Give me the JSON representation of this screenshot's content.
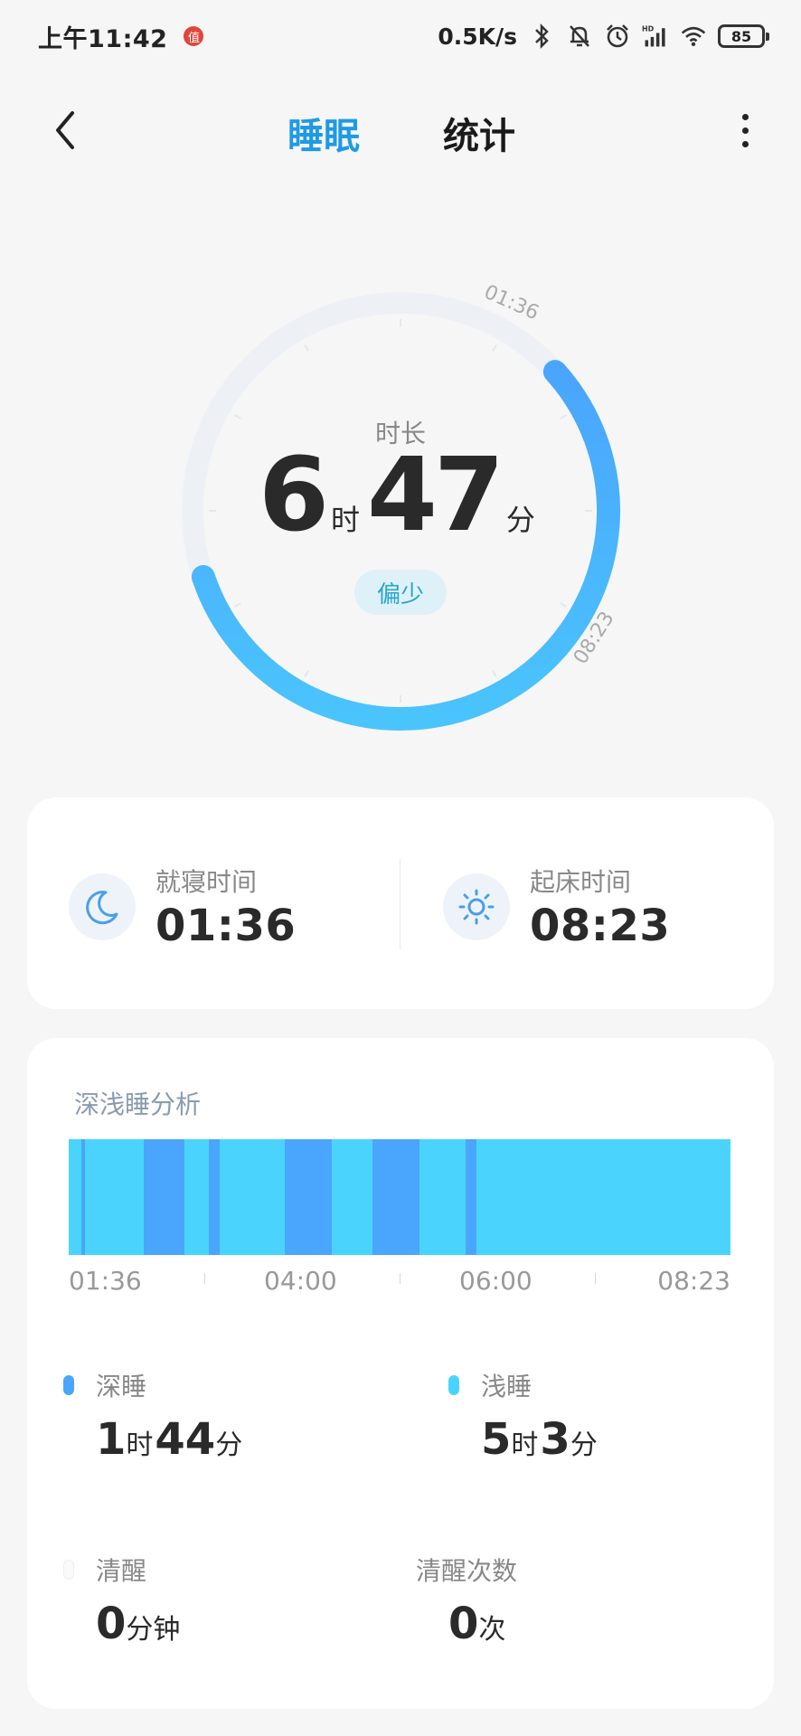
{
  "status_bar": {
    "time": "上午11:42",
    "app_icon_text": "值",
    "net_speed": "0.5K/s",
    "battery": "85",
    "icons": [
      "bluetooth-icon",
      "bell-muted-icon",
      "alarm-icon",
      "hd-signal-icon",
      "wifi-icon",
      "battery-icon"
    ]
  },
  "header": {
    "tabs": [
      {
        "label": "睡眠",
        "active": true
      },
      {
        "label": "统计",
        "active": false
      }
    ]
  },
  "summary": {
    "label": "时长",
    "hours": "6",
    "hours_unit": "时",
    "minutes": "47",
    "minutes_unit": "分",
    "quality": "偏少",
    "arc_start": "01:36",
    "arc_end": "08:23"
  },
  "times": {
    "bedtime": {
      "label": "就寝时间",
      "value": "01:36",
      "icon": "moon-icon"
    },
    "wake": {
      "label": "起床时间",
      "value": "08:23",
      "icon": "sun-icon"
    }
  },
  "analysis": {
    "title": "深浅睡分析",
    "axis": [
      "01:36",
      "04:00",
      "06:00",
      "08:23"
    ],
    "colors": {
      "light": "#4ad4fd",
      "deep": "#4aa5fd"
    },
    "deep_segments": [
      {
        "start": "01:44",
        "end": "01:46"
      },
      {
        "start": "02:22",
        "end": "02:47"
      },
      {
        "start": "03:02",
        "end": "03:09"
      },
      {
        "start": "03:49",
        "end": "04:18"
      },
      {
        "start": "04:43",
        "end": "05:12"
      },
      {
        "start": "05:40",
        "end": "05:47"
      }
    ],
    "stats": {
      "deep": {
        "label": "深睡",
        "h": "1",
        "h_unit": "时",
        "m": "44",
        "m_unit": "分"
      },
      "light": {
        "label": "浅睡",
        "h": "5",
        "h_unit": "时",
        "m": "3",
        "m_unit": "分"
      },
      "awake": {
        "label": "清醒",
        "value": "0",
        "unit": "分钟"
      },
      "awake_count": {
        "label": "清醒次数",
        "value": "0",
        "unit": "次"
      }
    }
  }
}
